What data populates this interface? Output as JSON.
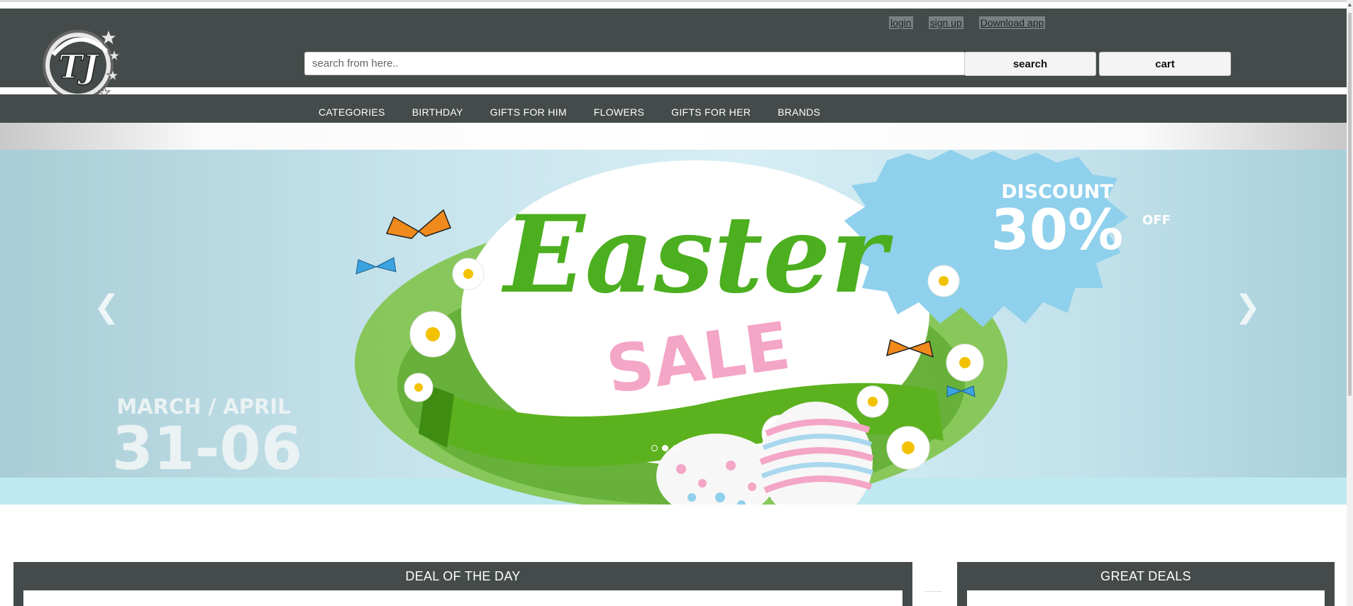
{
  "header": {
    "links": {
      "login": "login",
      "signup": "sign up",
      "download": "Download app"
    },
    "search": {
      "placeholder": "search from here..",
      "button": "search"
    },
    "cart": "cart"
  },
  "nav": {
    "items": [
      "CATEGORIES",
      "BIRTHDAY",
      "GIFTS FOR HIM",
      "FLOWERS",
      "GIFTS FOR HER",
      "BRANDS"
    ]
  },
  "banner": {
    "title_script": "Easter",
    "sale": "SALE",
    "discount_label": "DISCOUNT",
    "discount_value": "30%",
    "discount_off": "OFF",
    "date_label": "MARCH / APRIL",
    "date_range": "31-06",
    "slides_total": 4,
    "active_slide": 2
  },
  "sections": {
    "deal": "DEAL OF THE DAY",
    "great": "GREAT DEALS"
  },
  "colors": {
    "header_bg": "#444b4a",
    "easter_green": "#4caf1f",
    "sale_pink": "#f4a6c6",
    "discount_blue": "#8fd0ec"
  }
}
